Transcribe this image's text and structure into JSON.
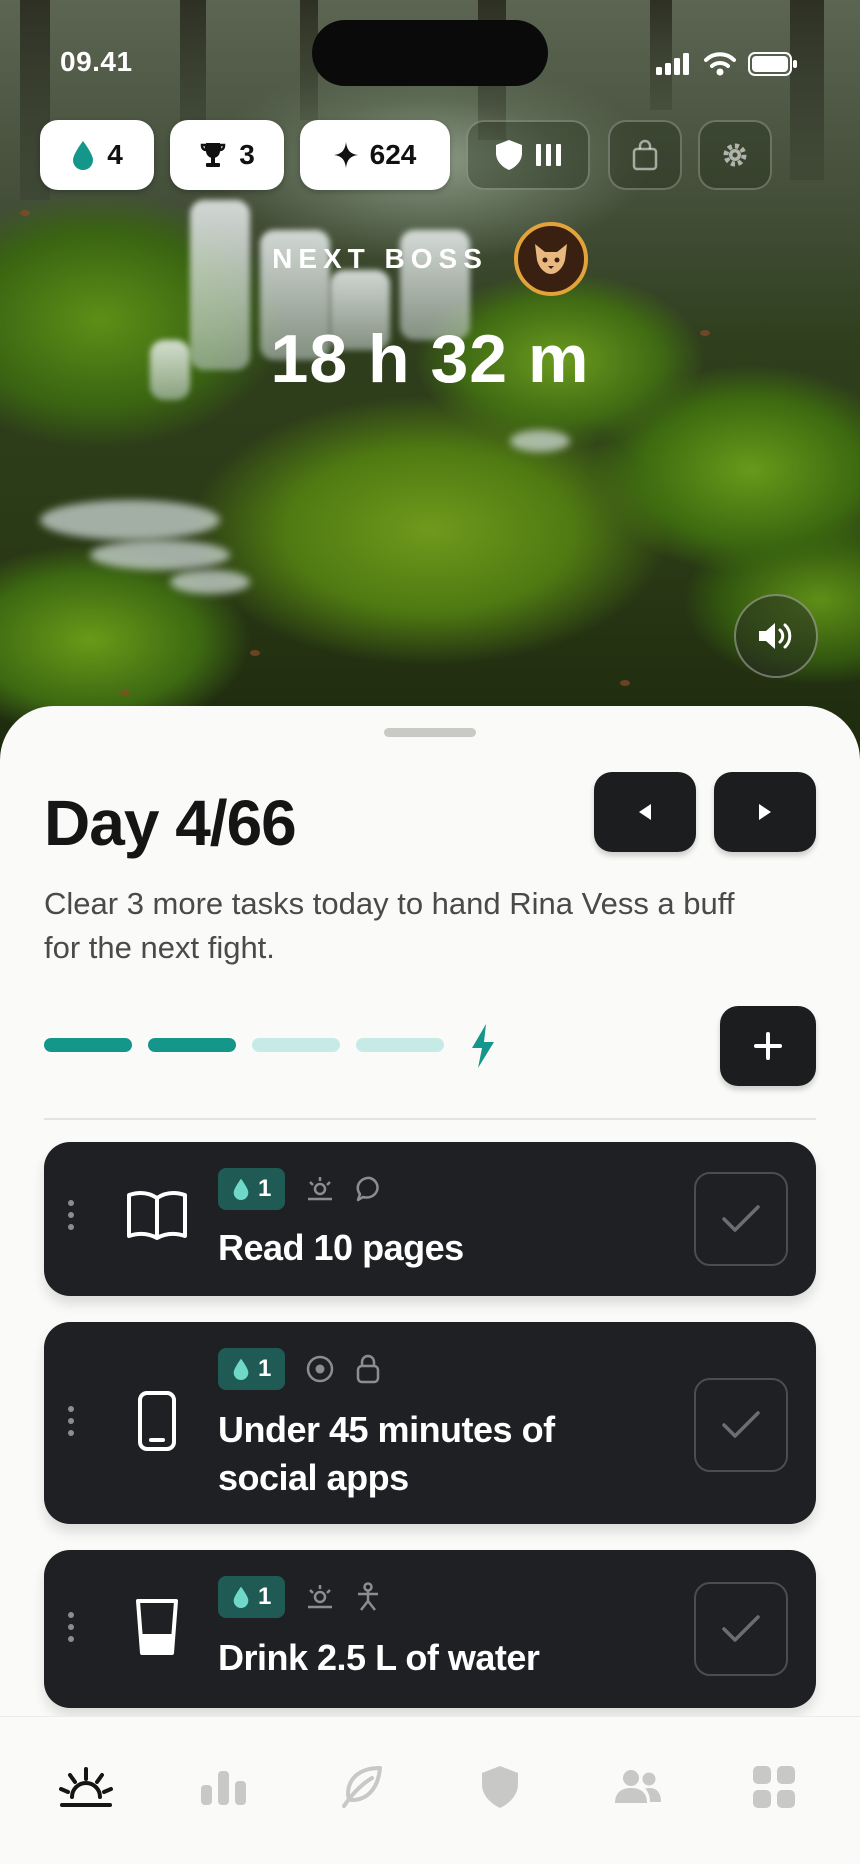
{
  "status_bar": {
    "time": "09.41"
  },
  "stats": {
    "drops": "4",
    "trophies": "3",
    "sparks": "624"
  },
  "boss": {
    "label": "NEXT BOSS",
    "countdown": "18 h 32 m"
  },
  "day": {
    "title": "Day 4/66",
    "subtitle": "Clear 3 more tasks today to hand Rina Vess a buff for the next fight.",
    "progress": {
      "completed_segments": 2,
      "total_segments": 4
    }
  },
  "tasks": [
    {
      "title": "Read 10 pages",
      "drops": "1",
      "icon": "book-icon",
      "tags": [
        "sun-icon",
        "chat-icon"
      ]
    },
    {
      "title": "Under 45 minutes of social apps",
      "drops": "1",
      "icon": "phone-icon",
      "tags": [
        "target-icon",
        "lock-icon"
      ]
    },
    {
      "title": "Drink 2.5 L of water",
      "drops": "1",
      "icon": "glass-icon",
      "tags": [
        "sun-icon",
        "person-icon"
      ]
    }
  ],
  "tabs": [
    "home-sunrise-icon",
    "stats-icon",
    "leaf-icon",
    "shield-icon",
    "people-icon",
    "grid-icon"
  ],
  "colors": {
    "teal": "#14968a",
    "teal_light": "#c6ebe6",
    "dark_card": "#1e2023",
    "boss_ring": "#e2a33a"
  }
}
